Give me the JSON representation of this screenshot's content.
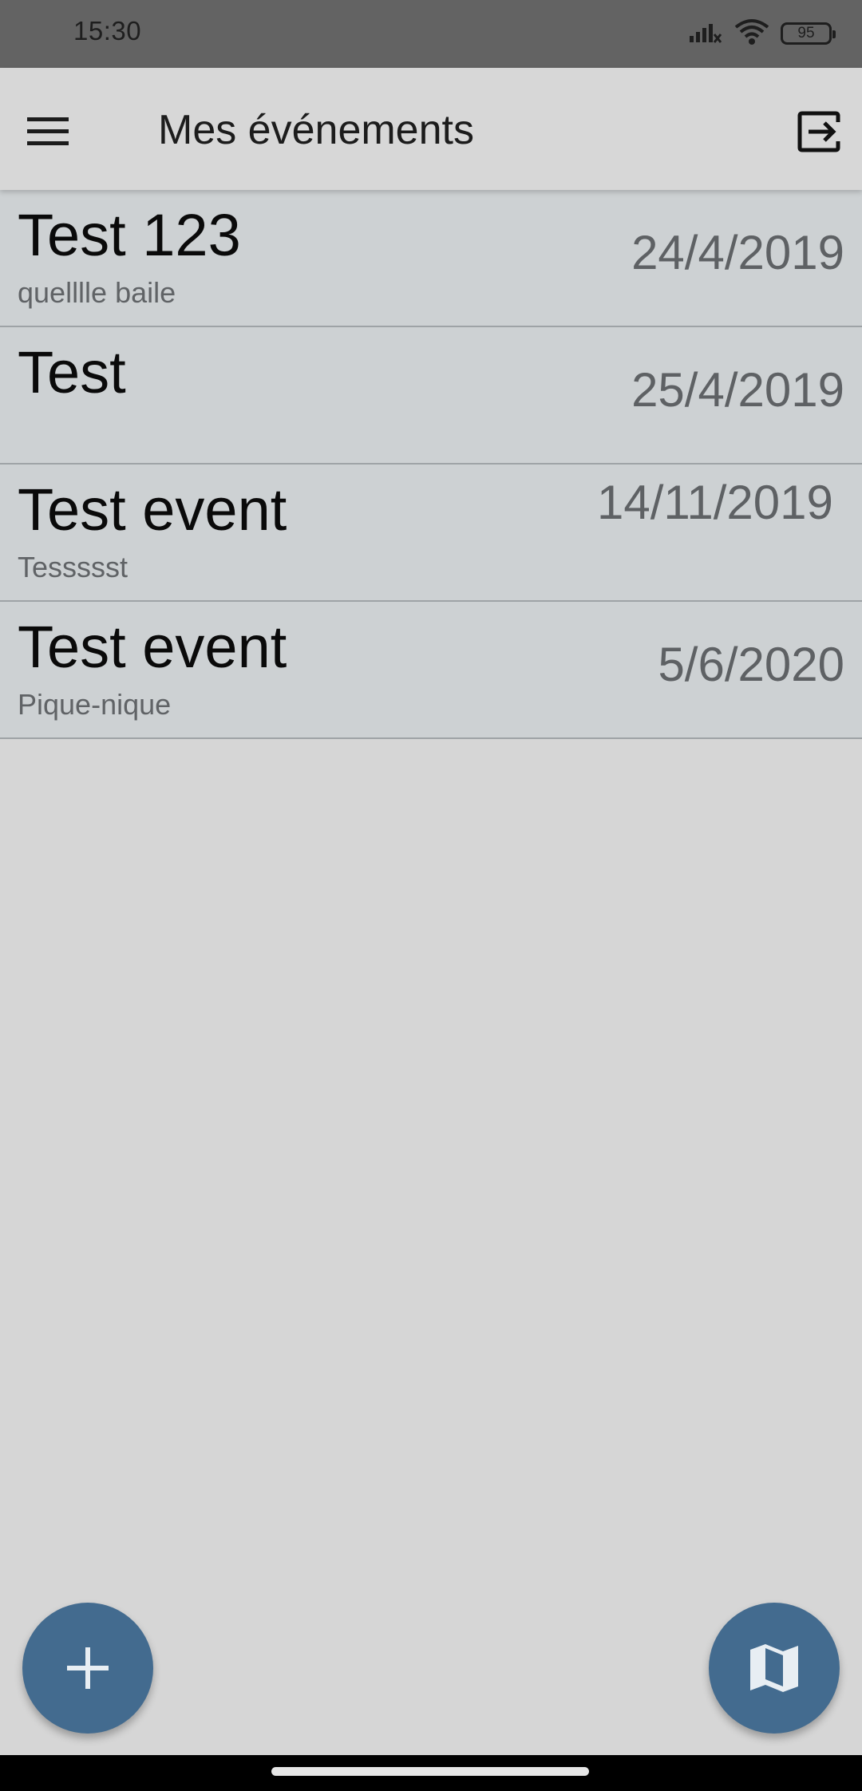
{
  "status_bar": {
    "time": "15:30",
    "battery_level": "95",
    "icons": [
      "signal-icon",
      "wifi-icon",
      "battery-icon"
    ]
  },
  "app_bar": {
    "title": "Mes événements",
    "menu_icon": "hamburger-menu-icon",
    "logout_icon": "logout-icon"
  },
  "events": [
    {
      "title": "Test 123",
      "subtitle": "quelllle baile",
      "date": "24/4/2019"
    },
    {
      "title": "Test",
      "subtitle": "",
      "date": "25/4/2019"
    },
    {
      "title": "Test event",
      "subtitle": "Tessssst",
      "date": "14/11/2019"
    },
    {
      "title": "Test event",
      "subtitle": "Pique-nique",
      "date": "5/6/2020"
    }
  ],
  "fabs": {
    "add_icon": "plus-icon",
    "map_icon": "map-icon"
  },
  "colors": {
    "status_bar": "#636363",
    "app_bar": "#d7d7d7",
    "background": "#d6d6d6",
    "list_item": "#cdd1d3",
    "fab": "#436b8f",
    "title_text": "#0a0a0a",
    "secondary_text": "#5e6164"
  }
}
